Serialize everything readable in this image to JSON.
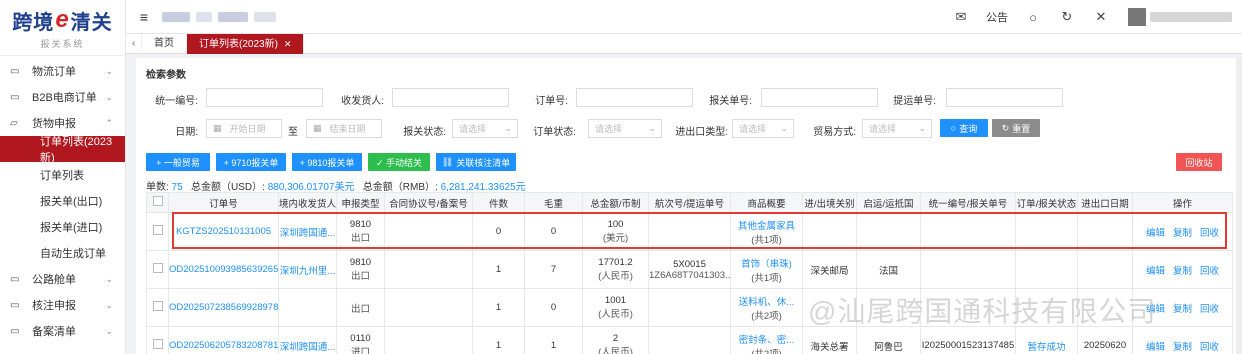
{
  "logo": {
    "brand": "跨境",
    "brand_e": "e",
    "brand_tail": "清关",
    "subtitle": "报关系统"
  },
  "sidebar": {
    "items": [
      {
        "label": "物流订单",
        "icon": "folder-icon"
      },
      {
        "label": "B2B电商订单",
        "icon": "folder-icon"
      },
      {
        "label": "货物申报",
        "icon": "folder-open-icon"
      },
      {
        "label": "公路舱单",
        "icon": "folder-icon"
      },
      {
        "label": "核注申报",
        "icon": "folder-icon"
      },
      {
        "label": "备案清单",
        "icon": "folder-icon"
      }
    ],
    "sub_items": [
      "订单列表(2023新)",
      "订单列表",
      "报关单(出口)",
      "报关单(进口)",
      "自动生成订单"
    ]
  },
  "topbar": {
    "notice": "公告"
  },
  "tabs": {
    "home": "首页",
    "active": "订单列表(2023新)"
  },
  "search": {
    "title": "检索参数",
    "unified_no": "统一编号:",
    "consignee": "收发货人:",
    "order_no": "订单号:",
    "declaration_no": "报关单号:",
    "bl_no": "提运单号:",
    "date": "日期:",
    "start_date": "开始日期",
    "to": "至",
    "end_date": "结束日期",
    "decl_status": "报关状态:",
    "order_status": "订单状态:",
    "ie_type": "进出口类型:",
    "trade_mode": "贸易方式:",
    "select_placeholder": "请选择",
    "query": "查询",
    "reset": "重置"
  },
  "actions": {
    "general_trade": "+ 一般贸易",
    "d9710": "+ 9710报关单",
    "d9810": "+ 9810报关单",
    "manual_close": "✓ 手动结关",
    "link_checklist": "关联核注清单",
    "recycle": "回收站"
  },
  "summary": {
    "count_label": "单数:",
    "count": "75",
    "usd_label": "总金额（USD）:",
    "usd": "880,306.01707美元",
    "rmb_label": "总金额（RMB）:",
    "rmb": "6,281,241.33625元"
  },
  "table": {
    "headers": [
      "订单号",
      "境内收发货人",
      "申报类型",
      "合同协议号/备案号",
      "件数",
      "毛重",
      "总金额/币制",
      "航次号/提运单号",
      "商品概要",
      "进/出境关别",
      "启运/运抵国",
      "统一编号/报关单号",
      "订单/报关状态",
      "进出口日期",
      "操作"
    ],
    "rows": [
      {
        "order_no": "KGTZS202510131005",
        "consignee": "深圳跨国通...",
        "type": "9810",
        "type2": "出口",
        "contract": "",
        "pieces": "0",
        "weight": "0",
        "amount": "100",
        "currency": "(美元)",
        "voyage": "",
        "voyage2": "",
        "goods": "其他金属家具",
        "goods2": "(共1项)",
        "port": "",
        "country": "",
        "unified": "",
        "status": "",
        "date": ""
      },
      {
        "order_no": "OD202510093985639265",
        "consignee": "深圳九州里...",
        "type": "9810",
        "type2": "出口",
        "contract": "",
        "pieces": "1",
        "weight": "7",
        "amount": "17701.2",
        "currency": "(人民币)",
        "voyage": "5X0015",
        "voyage2": "1Z6A68T7041303...",
        "goods": "首饰（串珠)",
        "goods2": "(共1项)",
        "port": "深关邮局",
        "country": "法国",
        "unified": "",
        "status": "",
        "date": ""
      },
      {
        "order_no": "OD202507238569928978",
        "consignee": "",
        "type": "",
        "type2": "出口",
        "contract": "",
        "pieces": "1",
        "weight": "0",
        "amount": "1001",
        "currency": "(人民币)",
        "voyage": "",
        "voyage2": "",
        "goods": "送料机、休...",
        "goods2": "(共2项)",
        "port": "",
        "country": "",
        "unified": "",
        "status": "",
        "date": ""
      },
      {
        "order_no": "OD202506205783208781",
        "consignee": "深圳跨国通...",
        "type": "0110",
        "type2": "进口",
        "contract": "",
        "pieces": "1",
        "weight": "1",
        "amount": "2",
        "currency": "(人民币)",
        "voyage": "",
        "voyage2": "",
        "goods": "密封条、密...",
        "goods2": "(共2项)",
        "port": "海关总署",
        "country": "阿鲁巴",
        "unified": "I20250001523137485",
        "status": "暂存成功",
        "date": "20250620"
      }
    ],
    "ops": {
      "edit": "编辑",
      "copy": "复制",
      "recycle": "回收"
    }
  },
  "watermark": "@汕尾跨国通科技有限公司"
}
